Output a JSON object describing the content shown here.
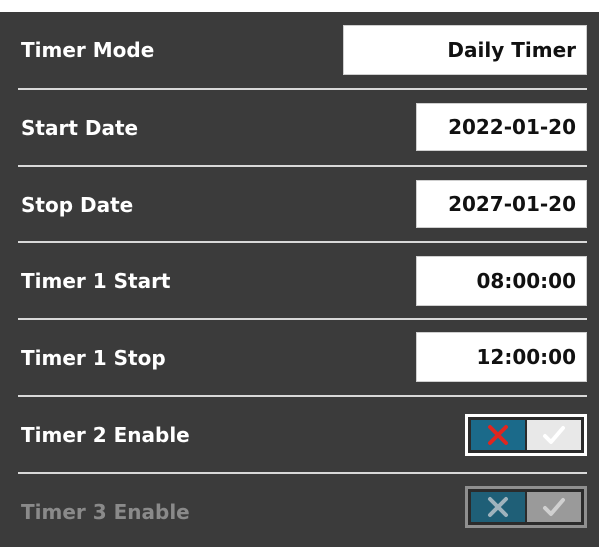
{
  "settings": {
    "timer_mode": {
      "label": "Timer Mode",
      "value": "Daily Timer"
    },
    "start_date": {
      "label": "Start Date",
      "value": "2022-01-20"
    },
    "stop_date": {
      "label": "Stop Date",
      "value": "2027-01-20"
    },
    "timer1_start": {
      "label": "Timer 1 Start",
      "value": "08:00:00"
    },
    "timer1_stop": {
      "label": "Timer 1 Stop",
      "value": "12:00:00"
    },
    "timer2_enable": {
      "label": "Timer 2 Enable",
      "state": "off",
      "enabled": true
    },
    "timer3_enable": {
      "label": "Timer 3 Enable",
      "state": "off",
      "enabled": false
    }
  },
  "icons": {
    "off": "x-icon",
    "on": "check-icon"
  },
  "colors": {
    "panel_bg": "#3b3b3b",
    "x_active": "#e0261f",
    "toggle_off_bg": "#1b6a8a"
  }
}
